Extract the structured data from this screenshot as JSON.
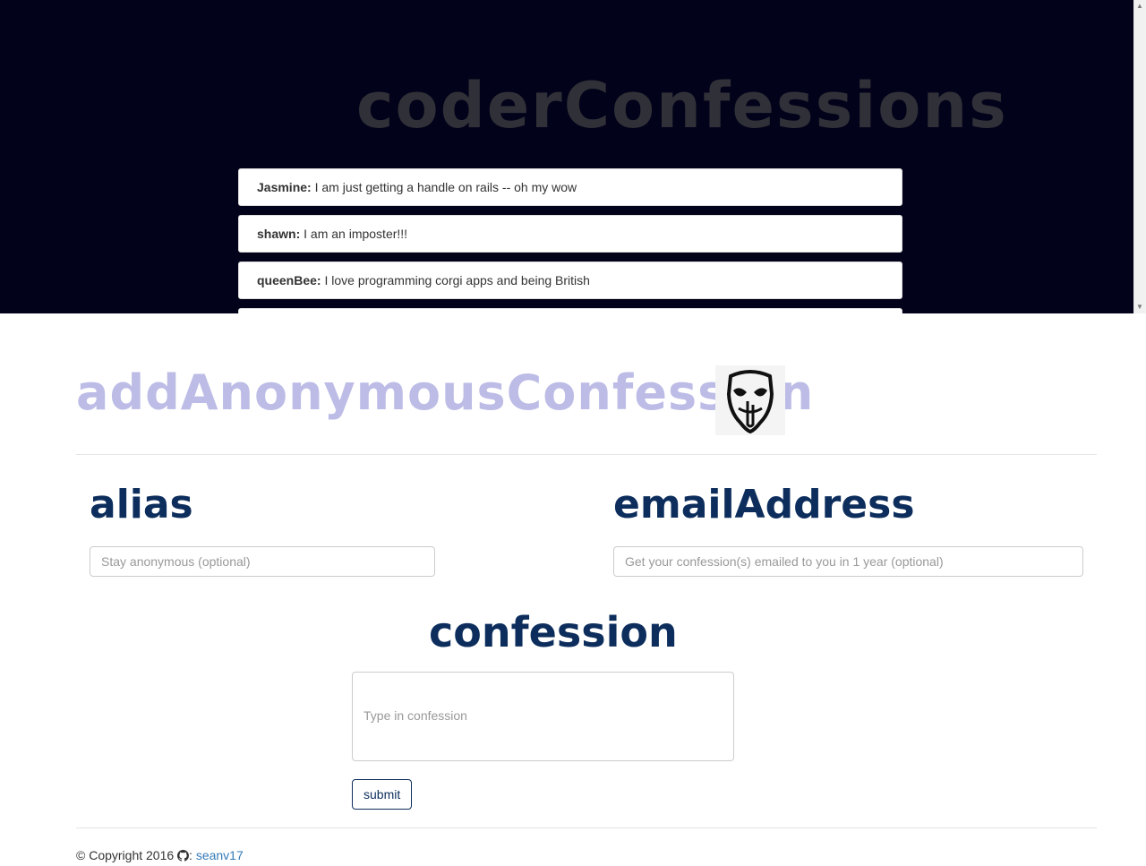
{
  "feed": {
    "title": "coderConfessions",
    "items": [
      {
        "alias": "Jasmine:",
        "text": " I am just getting a handle on rails -- oh my wow"
      },
      {
        "alias": "shawn:",
        "text": " I am an imposter!!!"
      },
      {
        "alias": "queenBee:",
        "text": " I love programming corgi apps and being British"
      },
      {
        "alias": "",
        "text": ""
      }
    ]
  },
  "form": {
    "heading": "addAnonymousConfession",
    "icon": "anonymous-mask-icon",
    "alias": {
      "label": "alias",
      "placeholder": "Stay anonymous (optional)"
    },
    "email": {
      "label": "emailAddress",
      "placeholder": "Get your confession(s) emailed to you in 1 year (optional)"
    },
    "confession": {
      "label": "confession",
      "placeholder": "Type in confession"
    },
    "submit_label": "submit"
  },
  "footer": {
    "copyright": "© Copyright 2016",
    "separator": ":",
    "author_link": "seanv17"
  },
  "colors": {
    "feed_bg": "#02021a",
    "label_navy": "#0d2e5c",
    "heading_lavender": "#bcbce6",
    "link": "#337ab7"
  }
}
